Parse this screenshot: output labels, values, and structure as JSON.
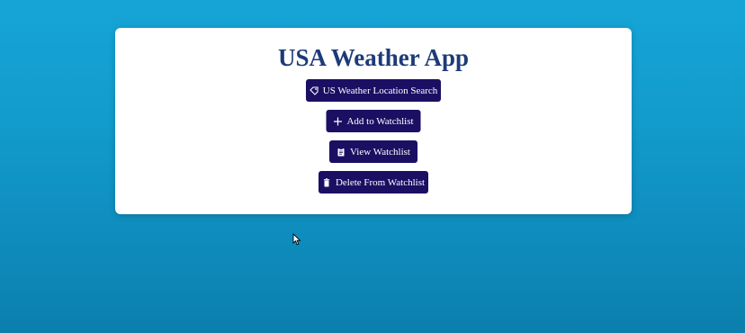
{
  "app": {
    "title": "USA Weather App"
  },
  "buttons": {
    "search": {
      "label": "US Weather Location Search",
      "icon": "location-tag-icon"
    },
    "add": {
      "label": "Add to Watchlist",
      "icon": "plus-icon"
    },
    "view": {
      "label": "View Watchlist",
      "icon": "clipboard-icon"
    },
    "delete": {
      "label": "Delete From Watchlist",
      "icon": "trash-icon"
    }
  },
  "colors": {
    "background_top": "#16a4d6",
    "background_bottom": "#0b7fad",
    "card": "#ffffff",
    "title": "#1d3b78",
    "button": "#1b0f63",
    "button_text": "#ffffff"
  }
}
